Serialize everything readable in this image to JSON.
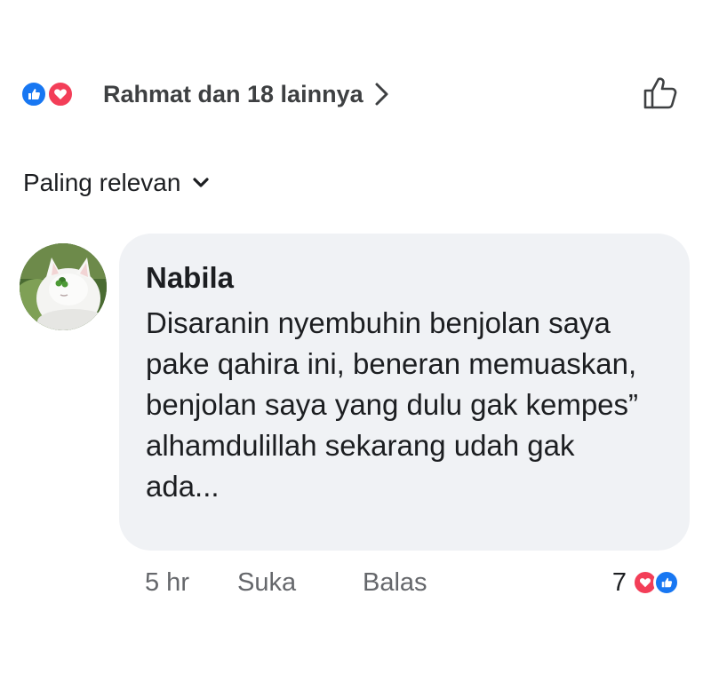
{
  "reactions": {
    "summary_text": "Rahmat dan 18 lainnya",
    "icons": [
      "like-icon",
      "love-icon"
    ],
    "colors": {
      "like": "#1877f2",
      "love": "#f33e58"
    }
  },
  "sort": {
    "label": "Paling relevan"
  },
  "comment": {
    "author": "Nabila",
    "text": "Disaranin nyembuhin benjolan saya pake qahira ini, beneran memuaskan, benjolan saya yang dulu gak kempes” alhamdulillah sekarang udah gak ada...",
    "time": "5 hr",
    "like_label": "Suka",
    "reply_label": "Balas",
    "reaction_count": "7",
    "reaction_icons": [
      "love-icon",
      "like-icon"
    ]
  }
}
